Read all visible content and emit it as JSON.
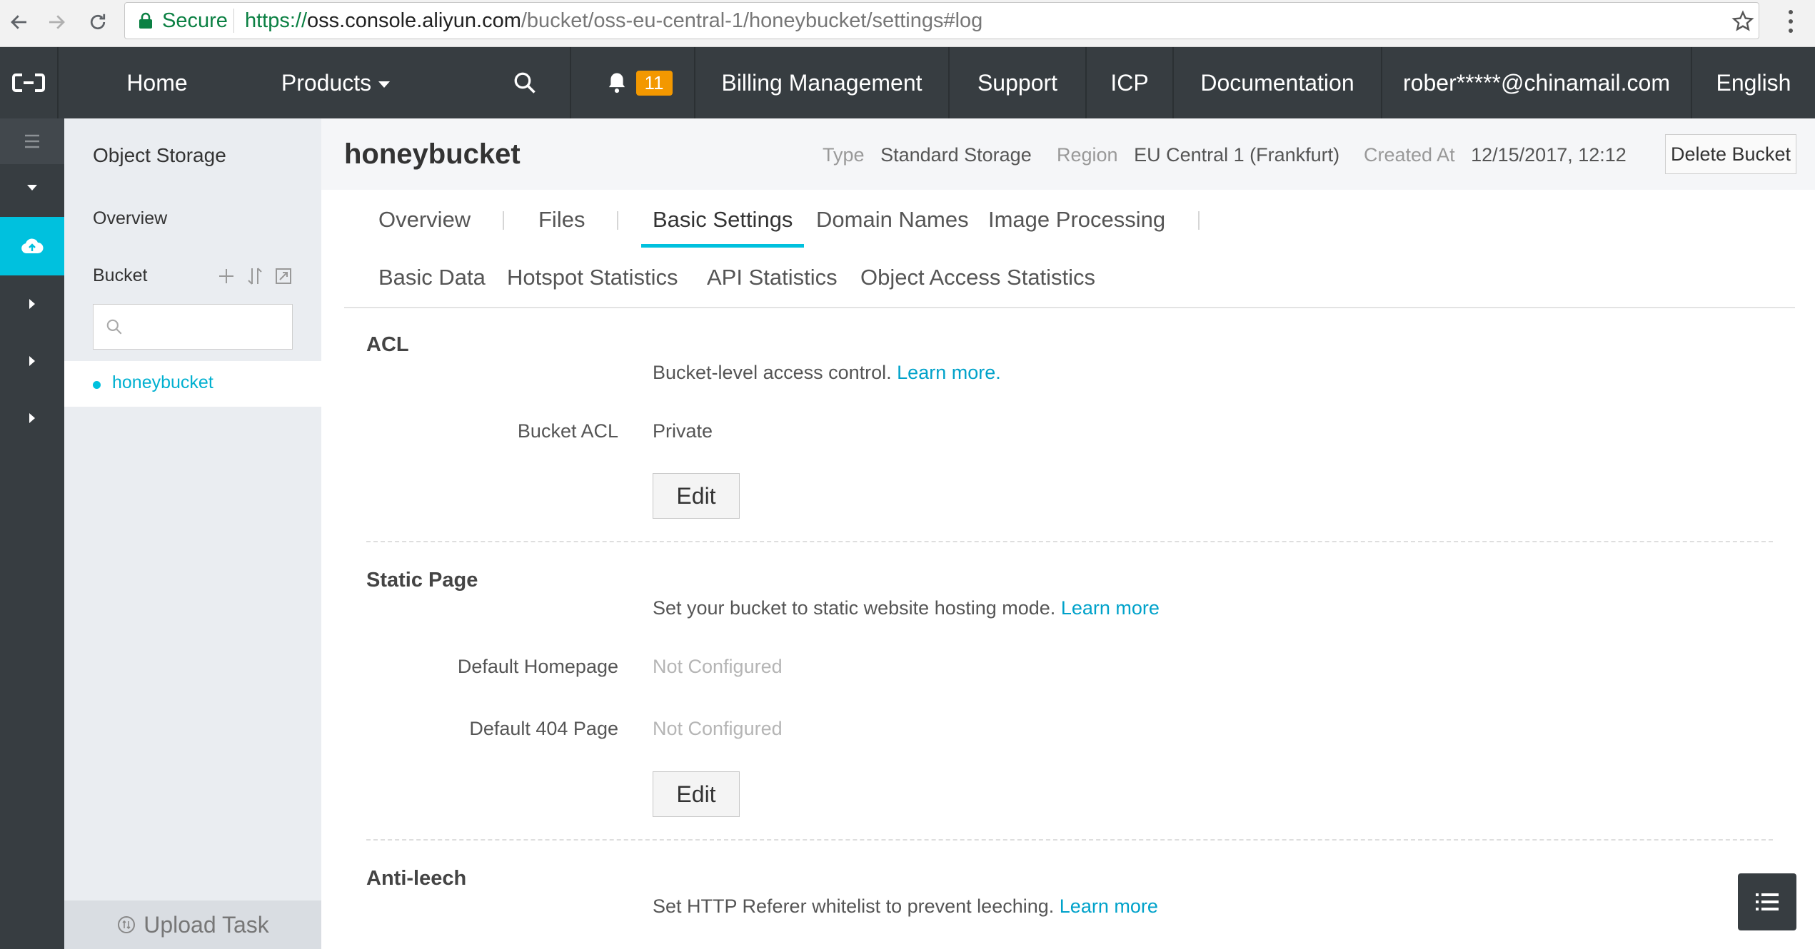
{
  "browser": {
    "secure_label": "Secure",
    "url_scheme": "https://",
    "url_host": "oss.console.aliyun.com",
    "url_path": "/bucket/oss-eu-central-1/honeybucket/settings#log"
  },
  "topnav": {
    "home": "Home",
    "products": "Products",
    "notification_count": "11",
    "billing": "Billing Management",
    "support": "Support",
    "icp": "ICP",
    "documentation": "Documentation",
    "account": "rober*****@chinamail.com",
    "language": "English"
  },
  "sidebar": {
    "title": "Object Storage",
    "overview": "Overview",
    "bucket_label": "Bucket",
    "search_placeholder": "",
    "active_bucket": "honeybucket",
    "upload_task": "Upload Task"
  },
  "header": {
    "bucket_name": "honeybucket",
    "type_label": "Type",
    "type_value": "Standard Storage",
    "region_label": "Region",
    "region_value": "EU Central 1 (Frankfurt)",
    "created_label": "Created At",
    "created_value": "12/15/2017, 12:12",
    "delete_button": "Delete Bucket"
  },
  "tabs": {
    "primary": [
      "Overview",
      "Files",
      "Basic Settings",
      "Domain Names",
      "Image Processing"
    ],
    "secondary": [
      "Basic Data",
      "Hotspot Statistics",
      "API Statistics",
      "Object Access Statistics"
    ],
    "active": "Basic Settings"
  },
  "acl": {
    "title": "ACL",
    "desc": "Bucket-level access control.",
    "learn_more": "Learn more.",
    "bucket_acl_label": "Bucket ACL",
    "bucket_acl_value": "Private",
    "edit": "Edit"
  },
  "static_page": {
    "title": "Static Page",
    "desc": "Set your bucket to static website hosting mode.",
    "learn_more": "Learn more",
    "homepage_label": "Default Homepage",
    "homepage_value": "Not Configured",
    "page404_label": "Default 404 Page",
    "page404_value": "Not Configured",
    "edit": "Edit"
  },
  "anti_leech": {
    "title": "Anti-leech",
    "desc": "Set HTTP Referer whitelist to prevent leeching.",
    "learn_more": "Learn more"
  },
  "colors": {
    "accent": "#00c1de",
    "nav_bg": "#373d41",
    "link": "#00a2ca",
    "badge": "#f39800"
  }
}
